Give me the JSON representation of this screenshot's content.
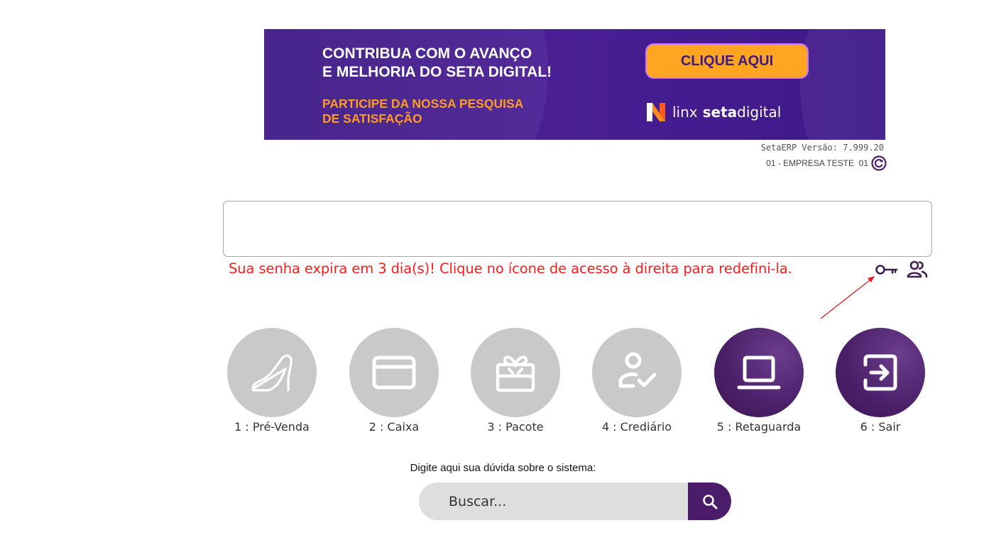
{
  "banner": {
    "headline": "CONTRIBUA COM O AVANÇO\nE MELHORIA DO SETA DIGITAL!",
    "subline": "PARTICIPE DA NOSSA PESQUISA\nDE SATISFAÇÃO",
    "cta_label": "CLIQUE AQUI",
    "brand_prefix": "linx",
    "brand_bold": "seta",
    "brand_suffix": "digital",
    "colors": {
      "background": "#4a1f94",
      "cta": "#ffa521",
      "subline": "#ff9b23"
    }
  },
  "version": {
    "text": "SetaERP Versão: 7.999.20",
    "company": "01 - EMPRESA TESTE  01"
  },
  "message": {
    "warning": "Sua senha expira em 3 dia(s)! Clique no ícone de acesso à direita para redefini-la.",
    "warning_color": "#ff1a1a",
    "icons": [
      "key-icon",
      "users-icon"
    ]
  },
  "modules": [
    {
      "label": "1 : Pré-Venda",
      "icon": "shoe-icon",
      "active": false
    },
    {
      "label": "2 : Caixa",
      "icon": "card-icon",
      "active": false
    },
    {
      "label": "3 : Pacote",
      "icon": "gift-icon",
      "active": false
    },
    {
      "label": "4 : Crediário",
      "icon": "user-check-icon",
      "active": false
    },
    {
      "label": "5 : Retaguarda",
      "icon": "laptop-icon",
      "active": true
    },
    {
      "label": "6 : Sair",
      "icon": "exit-icon",
      "active": true
    }
  ],
  "search": {
    "title": "Digite aqui sua dúvida sobre o sistema:",
    "placeholder": "Buscar..."
  },
  "colors": {
    "module_active": "#4a1f68",
    "module_inactive": "#c9c9c9"
  }
}
